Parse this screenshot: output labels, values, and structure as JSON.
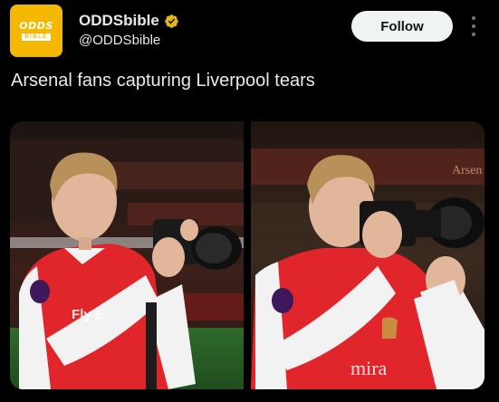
{
  "author": {
    "avatar_icon": "oddsbible-logo",
    "avatar_logo_top": "ODDS",
    "avatar_logo_bottom": "BIBLE",
    "display_name": "ODDSbible",
    "verified_icon": "verified-badge-icon",
    "handle": "@ODDSbible"
  },
  "actions": {
    "follow_label": "Follow",
    "more_icon": "more-vertical-icon"
  },
  "post": {
    "text": "Arsenal fans capturing Liverpool tears"
  },
  "media": {
    "count": 2,
    "stadium_sign": "Arsen",
    "shirt_sponsor_left": "Fly E",
    "shirt_sponsor_right": "mira"
  },
  "colors": {
    "background": "#000000",
    "follow_bg": "#eff3f4",
    "verified_gold": "#e2b719",
    "brand_yellow": "#f5b800",
    "arsenal_red": "#d71920"
  }
}
